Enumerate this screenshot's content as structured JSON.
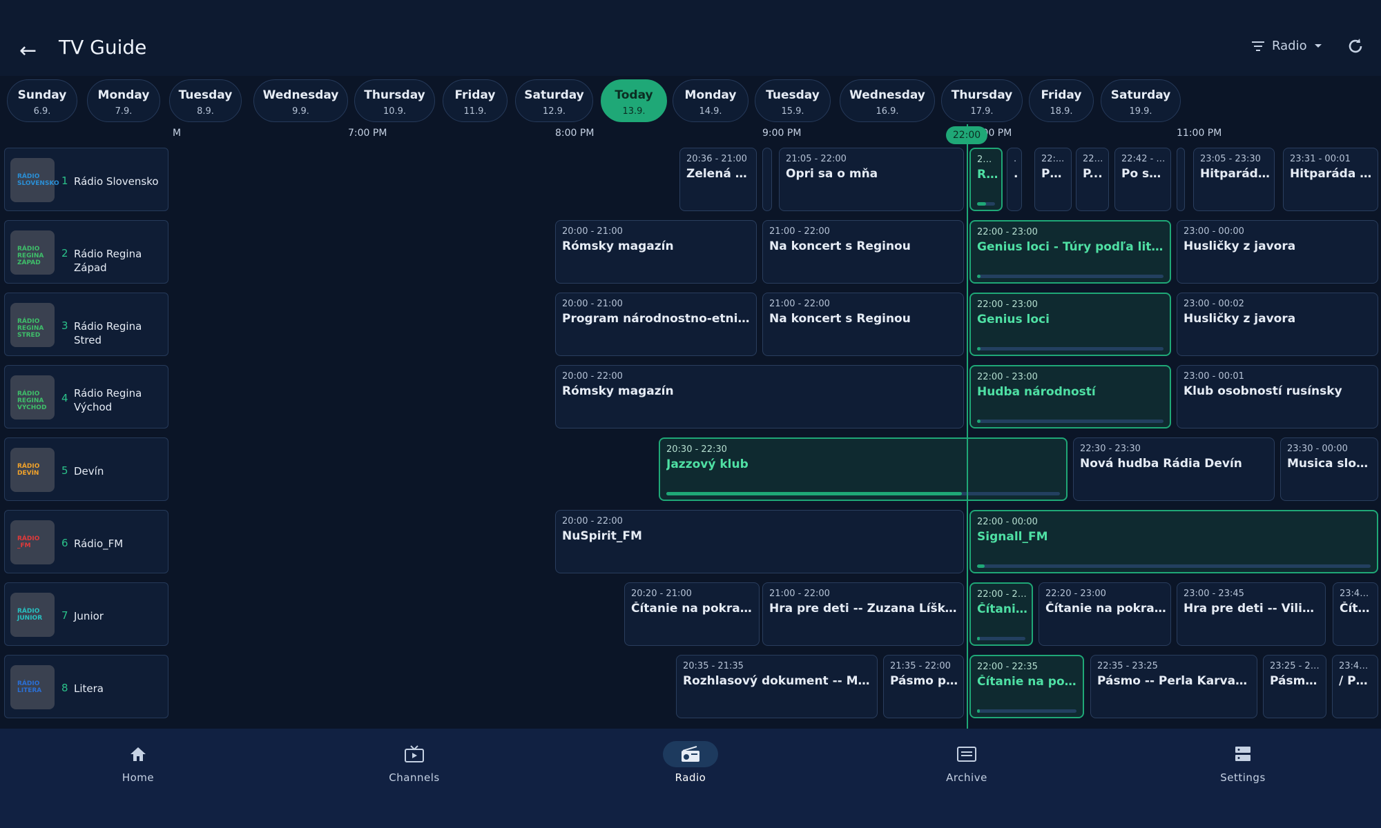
{
  "header": {
    "title": "TV Guide",
    "filter_label": "Radio"
  },
  "colors": {
    "accent": "#1fa877",
    "background": "#0b1527",
    "card": "#0f1d35"
  },
  "days": [
    {
      "name": "Sunday",
      "date": "6.9."
    },
    {
      "name": "Monday",
      "date": "7.9."
    },
    {
      "name": "Tuesday",
      "date": "8.9."
    },
    {
      "name": "Wednesday",
      "date": "9.9."
    },
    {
      "name": "Thursday",
      "date": "10.9."
    },
    {
      "name": "Friday",
      "date": "11.9."
    },
    {
      "name": "Saturday",
      "date": "12.9."
    },
    {
      "name": "Today",
      "date": "13.9."
    },
    {
      "name": "Monday",
      "date": "14.9."
    },
    {
      "name": "Tuesday",
      "date": "15.9."
    },
    {
      "name": "Wednesday",
      "date": "16.9."
    },
    {
      "name": "Thursday",
      "date": "17.9."
    },
    {
      "name": "Friday",
      "date": "18.9."
    },
    {
      "name": "Saturday",
      "date": "19.9."
    }
  ],
  "timeline": {
    "ticks": [
      "M",
      "7:00 PM",
      "8:00 PM",
      "9:00 PM",
      "10:00 PM",
      "11:00 PM"
    ],
    "now": "22:00"
  },
  "channels": [
    {
      "num": "1",
      "name": "Rádio Slovensko",
      "logo": "RÁDIO SLOVENSKO",
      "logo_color": "#2a8fd6"
    },
    {
      "num": "2",
      "name": "Rádio Regina Západ",
      "logo": "RÁDIO REGINA ZÁPAD",
      "logo_color": "#3fbf6a"
    },
    {
      "num": "3",
      "name": "Rádio Regina Stred",
      "logo": "RÁDIO REGINA STRED",
      "logo_color": "#3fbf6a"
    },
    {
      "num": "4",
      "name": "Rádio Regina Východ",
      "logo": "RÁDIO REGINA VÝCHOD",
      "logo_color": "#3fbf6a"
    },
    {
      "num": "5",
      "name": "Devín",
      "logo": "RÁDIO DEVÍN",
      "logo_color": "#f2a32a"
    },
    {
      "num": "6",
      "name": "Rádio_FM",
      "logo": "RÁDIO _FM",
      "logo_color": "#e23a3a"
    },
    {
      "num": "7",
      "name": "Junior",
      "logo": "RÁDIO JUNIOR",
      "logo_color": "#28c0c0"
    },
    {
      "num": "8",
      "name": "Litera",
      "logo": "RÁDIO LITERA",
      "logo_color": "#2a6fd6"
    }
  ],
  "programs": [
    [
      {
        "time": "20:36 - 21:00",
        "title": "Zelená vlna"
      },
      {
        "time": "",
        "title": ""
      },
      {
        "time": "21:05 - 22:00",
        "title": "Opri sa o mňa"
      },
      {
        "time": "22:...",
        "title": "R...",
        "now": true,
        "progress": 0.5
      },
      {
        "time": "..",
        "title": ".."
      },
      {
        "time": "22:...",
        "title": "Po..."
      },
      {
        "time": "22:...",
        "title": "P..."
      },
      {
        "time": "22:42 - 2...",
        "title": "Po sto..."
      },
      {
        "time": "",
        "title": ""
      },
      {
        "time": "23:05 - 23:30",
        "title": "Hitparáda ..."
      },
      {
        "time": "23:31 - 00:01",
        "title": "Hitparáda TO..."
      }
    ],
    [
      {
        "time": "20:00 - 21:00",
        "title": "Rómsky magazín"
      },
      {
        "time": "21:00 - 22:00",
        "title": "Na koncert s Reginou"
      },
      {
        "time": "22:00 - 23:00",
        "title": "Genius loci - Túry podľa literatúry",
        "now": true,
        "progress": 0.02
      },
      {
        "time": "23:00 - 00:00",
        "title": "Husličky z javora"
      }
    ],
    [
      {
        "time": "20:00 - 21:00",
        "title": "Program národnostno-etnického ..."
      },
      {
        "time": "21:00 - 22:00",
        "title": "Na koncert s Reginou"
      },
      {
        "time": "22:00 - 23:00",
        "title": "Genius loci",
        "now": true,
        "progress": 0.02
      },
      {
        "time": "23:00 - 00:02",
        "title": "Husličky z javora"
      }
    ],
    [
      {
        "time": "20:00 - 22:00",
        "title": "Rómsky magazín"
      },
      {
        "time": "22:00 - 23:00",
        "title": "Hudba národností",
        "now": true,
        "progress": 0.02
      },
      {
        "time": "23:00 - 00:01",
        "title": "Klub osobností rusínsky"
      }
    ],
    [
      {
        "time": "20:30 - 22:30",
        "title": "Jazzový klub",
        "now": true,
        "progress": 0.75
      },
      {
        "time": "22:30 - 23:30",
        "title": "Nová hudba Rádia Devín"
      },
      {
        "time": "23:30 - 00:00",
        "title": "Musica slovaca"
      }
    ],
    [
      {
        "time": "20:00 - 22:00",
        "title": "NuSpirit_FM"
      },
      {
        "time": "22:00 - 00:00",
        "title": "Signall_FM",
        "now": true,
        "progress": 0.01
      }
    ],
    [
      {
        "time": "20:20 - 21:00",
        "title": "Čítanie na pokračov..."
      },
      {
        "time": "21:00 - 22:00",
        "title": "Hra pre deti -- Zuzana Líšková: In..."
      },
      {
        "time": "22:00 - 22:...",
        "title": "Čítanie ...",
        "now": true,
        "progress": 0.05
      },
      {
        "time": "22:20 - 23:00",
        "title": "Čítanie na pokračov..."
      },
      {
        "time": "23:00 - 23:45",
        "title": "Hra pre deti -- Viliam Kli..."
      },
      {
        "time": "23:45 ...",
        "title": "Číta..."
      }
    ],
    [
      {
        "time": "20:35 - 21:35",
        "title": "Rozhlasový dokument -- Marcel ..."
      },
      {
        "time": "21:35 - 22:00",
        "title": "Pásmo po..."
      },
      {
        "time": "22:00 - 22:35",
        "title": "Čítanie na pokrač...",
        "now": true,
        "progress": 0.03
      },
      {
        "time": "22:35 - 23:25",
        "title": "Pásmo -- Perla Karvašová: ..."
      },
      {
        "time": "23:25 - 23:...",
        "title": "Pásmo ..."
      },
      {
        "time": "23:45 ...",
        "title": "/ PR..."
      }
    ]
  ],
  "nav": [
    {
      "label": "Home",
      "icon": "home-icon"
    },
    {
      "label": "Channels",
      "icon": "tv-icon"
    },
    {
      "label": "Radio",
      "icon": "radio-icon",
      "active": true
    },
    {
      "label": "Archive",
      "icon": "archive-icon"
    },
    {
      "label": "Settings",
      "icon": "settings-icon"
    }
  ]
}
